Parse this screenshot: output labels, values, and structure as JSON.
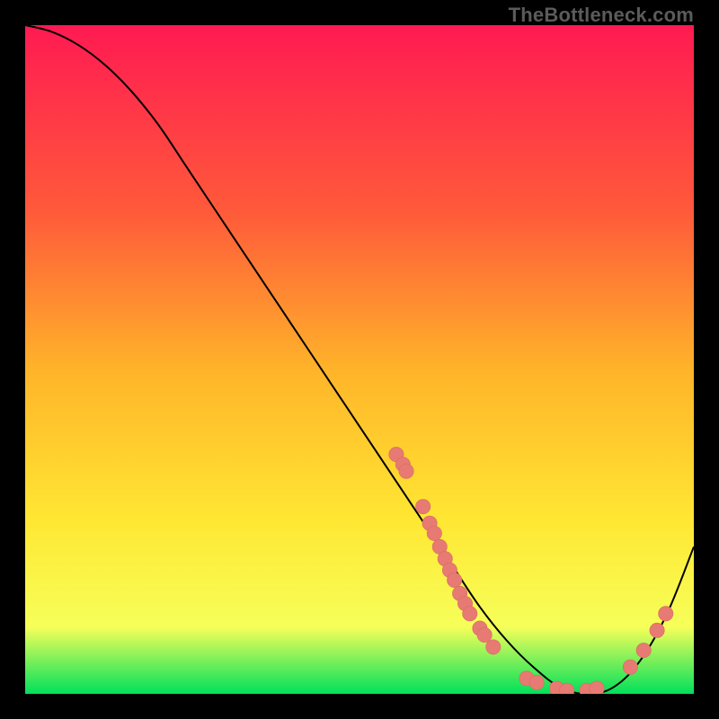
{
  "watermark": "TheBottleneck.com",
  "colors": {
    "background": "#000000",
    "gradient_top": "#ff1a52",
    "gradient_mid1": "#ff5a3a",
    "gradient_mid2": "#ffb529",
    "gradient_mid3": "#ffe733",
    "gradient_mid4": "#f6ff59",
    "gradient_bottom": "#00e05a",
    "curve": "#000000",
    "marker_fill": "#e77a72",
    "marker_stroke": "#d96b63"
  },
  "chart_data": {
    "type": "line",
    "title": "",
    "xlabel": "",
    "ylabel": "",
    "xlim": [
      0,
      100
    ],
    "ylim": [
      0,
      100
    ],
    "series": [
      {
        "name": "bottleneck-curve",
        "x": [
          0,
          4,
          8,
          12,
          16,
          20,
          24,
          28,
          32,
          36,
          40,
          44,
          48,
          52,
          56,
          60,
          64,
          68,
          72,
          76,
          80,
          84,
          88,
          92,
          96,
          100
        ],
        "y": [
          100,
          99,
          97,
          94,
          90,
          85,
          79,
          73,
          67,
          61,
          55,
          49,
          43,
          37,
          31,
          25,
          19,
          13,
          8,
          4,
          1,
          0,
          1,
          5,
          12,
          22
        ]
      }
    ],
    "markers": [
      {
        "x": 55.5,
        "y": 35.8,
        "r": 1.1
      },
      {
        "x": 56.5,
        "y": 34.3,
        "r": 1.1
      },
      {
        "x": 57.0,
        "y": 33.3,
        "r": 1.1
      },
      {
        "x": 59.5,
        "y": 28.0,
        "r": 1.1
      },
      {
        "x": 60.5,
        "y": 25.5,
        "r": 1.1
      },
      {
        "x": 61.2,
        "y": 24.0,
        "r": 1.1
      },
      {
        "x": 62.0,
        "y": 22.0,
        "r": 1.1
      },
      {
        "x": 62.8,
        "y": 20.2,
        "r": 1.1
      },
      {
        "x": 63.5,
        "y": 18.5,
        "r": 1.1
      },
      {
        "x": 64.2,
        "y": 17.0,
        "r": 1.1
      },
      {
        "x": 65.0,
        "y": 15.0,
        "r": 1.1
      },
      {
        "x": 65.8,
        "y": 13.5,
        "r": 1.1
      },
      {
        "x": 66.5,
        "y": 12.0,
        "r": 1.1
      },
      {
        "x": 68.0,
        "y": 9.8,
        "r": 1.1
      },
      {
        "x": 68.7,
        "y": 8.8,
        "r": 1.1
      },
      {
        "x": 70.0,
        "y": 7.0,
        "r": 1.1
      },
      {
        "x": 75.0,
        "y": 2.3,
        "r": 1.1
      },
      {
        "x": 76.5,
        "y": 1.7,
        "r": 1.1
      },
      {
        "x": 79.5,
        "y": 0.8,
        "r": 1.1
      },
      {
        "x": 81.0,
        "y": 0.5,
        "r": 1.1
      },
      {
        "x": 84.0,
        "y": 0.5,
        "r": 1.1
      },
      {
        "x": 85.5,
        "y": 0.8,
        "r": 1.1
      },
      {
        "x": 90.5,
        "y": 4.0,
        "r": 1.1
      },
      {
        "x": 92.5,
        "y": 6.5,
        "r": 1.1
      },
      {
        "x": 94.5,
        "y": 9.5,
        "r": 1.1
      },
      {
        "x": 95.8,
        "y": 12.0,
        "r": 1.1
      }
    ]
  }
}
